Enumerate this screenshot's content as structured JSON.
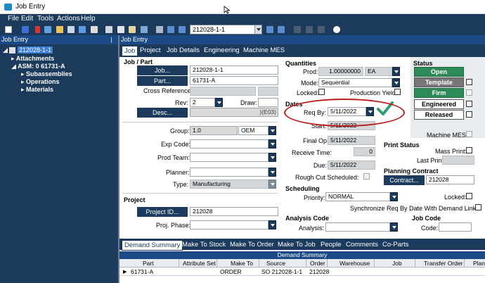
{
  "window": {
    "title": "Job Entry"
  },
  "menu": [
    "File",
    "Edit",
    "Tools",
    "Actions",
    "Help"
  ],
  "toolbar": {
    "job_combo": "212028-1-1"
  },
  "tree": {
    "header": "Job Entry",
    "root": "212028-1-1",
    "items": [
      "Attachments",
      "ASM: 0 61731-A",
      "Subassemblies",
      "Operations",
      "Materials"
    ]
  },
  "main": {
    "header": "Job Entry",
    "tabs": [
      "Job",
      "Project",
      "Job Details",
      "Engineering",
      "Machine MES"
    ]
  },
  "job_part": {
    "title": "Job / Part",
    "job_button": "Job...",
    "job_value": "212028-1-1",
    "part_button": "Part...",
    "part_value": "61731-A",
    "crossref_label": "Cross Reference:",
    "rev_label": "Rev:",
    "rev_value": "2",
    "draw_label": "Draw:",
    "desc_button": "Desc...",
    "desc_value": ")(E03)",
    "group_label": "Group:",
    "group_value": "1.0",
    "group_value2": "OEM",
    "expcode_label": "Exp Code:",
    "prodteam_label": "Prod Team:",
    "planner_label": "Planner:",
    "type_label": "Type:",
    "type_value": "Manufacturing"
  },
  "project": {
    "title": "Project",
    "project_button": "Project ID...",
    "project_value": "212028",
    "phase_label": "Proj. Phase:"
  },
  "quantities": {
    "title": "Quantities",
    "prod_label": "Prod:",
    "prod_value": "1.00000000",
    "uom": "EA",
    "mode_label": "Mode:",
    "mode_value": "Sequential",
    "locked_label": "Locked:",
    "yield_label": "Production Yield:"
  },
  "dates": {
    "title": "Dates",
    "reqby_label": "Req By:",
    "reqby_value": "5/11/2022",
    "start_label": "Start:",
    "start_value": "5/11/2022",
    "finalop_label": "Final Op:",
    "finalop_value": "5/11/2022",
    "receive_label": "Receive Time:",
    "receive_value": "0",
    "due_label": "Due:",
    "due_value": "5/11/2022",
    "rough_label": "Rough Cut Scheduled:"
  },
  "scheduling": {
    "title": "Scheduling",
    "priority_label": "Priority:",
    "priority_value": "NORMAL",
    "sync_label": "Synchronize Req By Date With Demand Links:"
  },
  "analysis": {
    "title": "Analysis Code",
    "analysis_label": "Analysis:"
  },
  "status": {
    "title": "Status",
    "open": "Open",
    "template": "Template",
    "firm": "Firm",
    "engineered": "Engineered",
    "released": "Released",
    "machine_mes_label": "Machine MES:"
  },
  "print_status": {
    "title": "Print Status",
    "mass_print_label": "Mass Print:",
    "last_printed_label": "Last Printed:"
  },
  "planning": {
    "title": "Planning Contract",
    "contract_button": "Contract...",
    "contract_value": "212028",
    "locked_label": "Locked:"
  },
  "jobcode": {
    "title": "Job Code",
    "code_label": "Code:"
  },
  "bottom_tabs": [
    "Demand Summary",
    "Make To Stock",
    "Make To Order",
    "Make To Job",
    "People",
    "Comments",
    "Co-Parts"
  ],
  "grid": {
    "title": "Demand Summary",
    "columns": [
      "Part",
      "Attribute Set",
      "Make To",
      "Source",
      "Order",
      "Warehouse",
      "Job",
      "Transfer Order",
      "Plant"
    ],
    "rows": [
      {
        "part": "61731-A",
        "attribute_set": "",
        "make_to": "ORDER",
        "source": "SO 212028-1-1",
        "order": "212028",
        "warehouse": "",
        "job": "",
        "transfer_order": "",
        "plant": ""
      }
    ]
  },
  "colors": {
    "navy": "#1b3a5c",
    "header_blue": "#1b4a86",
    "annotation_red": "#b81e1e",
    "check_green": "#2e9e6e"
  }
}
